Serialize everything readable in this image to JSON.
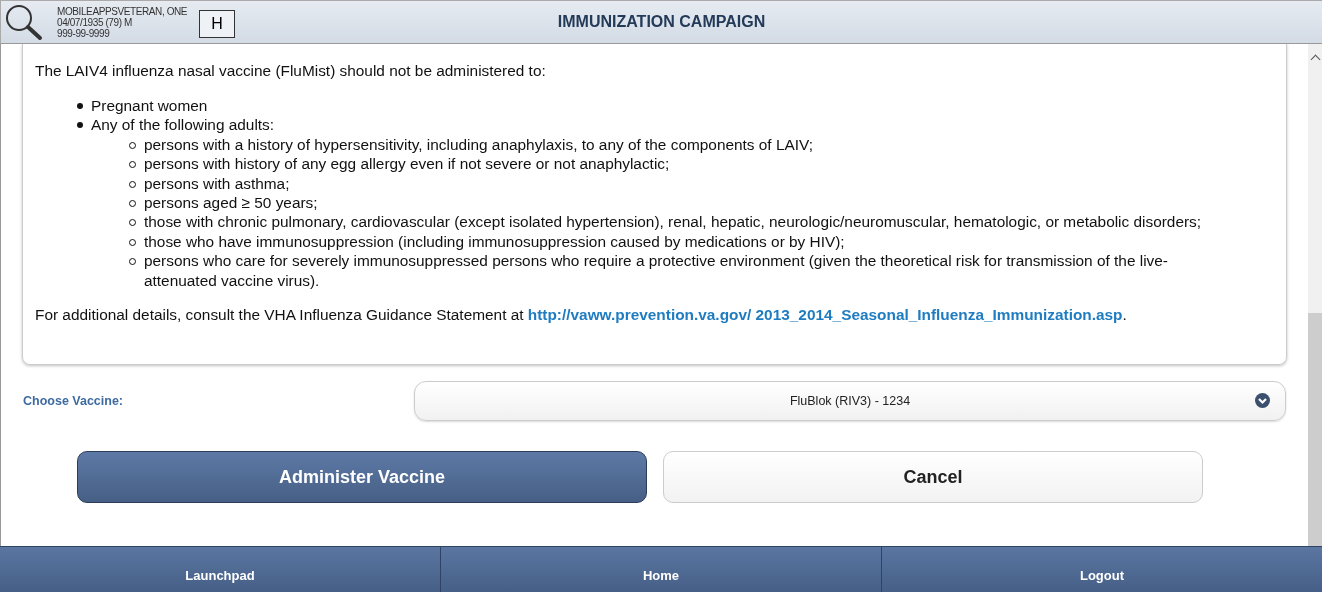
{
  "header": {
    "patient": {
      "name": "MOBILEAPPSVETERAN, ONE",
      "details": "04/07/1935 (79) M",
      "ssn": "999-99-9999"
    },
    "record_flag": "H",
    "title": "IMMUNIZATION CAMPAIGN"
  },
  "notice": {
    "intro": "The LAIV4 influenza nasal vaccine (FluMist) should not be administered to:",
    "items": [
      {
        "text": "Pregnant women"
      },
      {
        "text": "Any of the following adults:",
        "children": [
          {
            "text": "persons with a history of hypersensitivity, including anaphylaxis, to any of the components of LAIV;"
          },
          {
            "text": "persons with history of any egg allergy even if not severe or not anaphylactic;"
          },
          {
            "text": "persons with asthma;"
          },
          {
            "text": "persons aged ≥ 50 years;"
          },
          {
            "text": "those with chronic pulmonary, cardiovascular (except isolated hypertension), renal, hepatic, neurologic/neuromuscular, hematologic, or metabolic disorders;"
          },
          {
            "text": "those who have immunosuppression (including immunosuppression caused by medications or by HIV);"
          },
          {
            "text": "persons who care for severely immunosuppressed persons who require a protective environment (given the theoretical risk for transmission of the live-attenuated vaccine virus)."
          }
        ]
      }
    ],
    "footer_text": "For additional details, consult the VHA Influenza Guidance Statement at ",
    "link": "http://vaww.prevention.va.gov/ 2013_2014_Seasonal_Influenza_Immunization.asp",
    "footer_end": "."
  },
  "vaccine": {
    "label": "Choose Vaccine:",
    "value": "FluBlok (RIV3) - 1234"
  },
  "buttons": [
    {
      "label": "Administer Vaccine",
      "kind": "primary"
    },
    {
      "label": "Cancel",
      "kind": "secondary"
    }
  ],
  "nav": [
    {
      "label": "Launchpad"
    },
    {
      "label": "Home"
    },
    {
      "label": "Logout"
    }
  ]
}
